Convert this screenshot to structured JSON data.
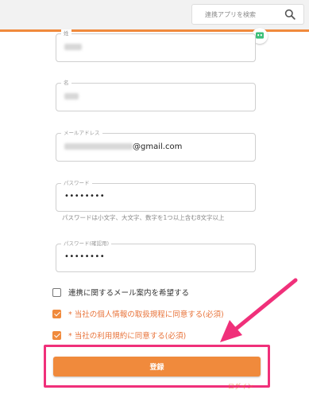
{
  "header": {
    "search_placeholder": "連携アプリを検索",
    "search_icon": "search-icon",
    "chat_icon": "chat-icon"
  },
  "form": {
    "fields": [
      {
        "label": "姓",
        "value": ""
      },
      {
        "label": "名",
        "value": ""
      },
      {
        "label": "メールアドレス",
        "value_suffix": "@gmail.com"
      },
      {
        "label": "パスワード",
        "value": "••••••••"
      },
      {
        "label": "パスワード(確認用)",
        "value": "••••••••"
      }
    ],
    "password_hint": "パスワードは小文字、大文字、数字を1つ以上含む8文字以上",
    "checkboxes": [
      {
        "label": "連携に関するメール案内を希望する",
        "checked": false
      },
      {
        "label": "* 当社の個人情報の取扱規程に同意する(必須)",
        "checked": true
      },
      {
        "label": "* 当社の利用規約に同意する(必須)",
        "checked": true
      }
    ],
    "submit_label": "登録",
    "login_link": "ログイン"
  },
  "colors": {
    "accent": "#f08a3c",
    "annotation": "#f0307a"
  }
}
